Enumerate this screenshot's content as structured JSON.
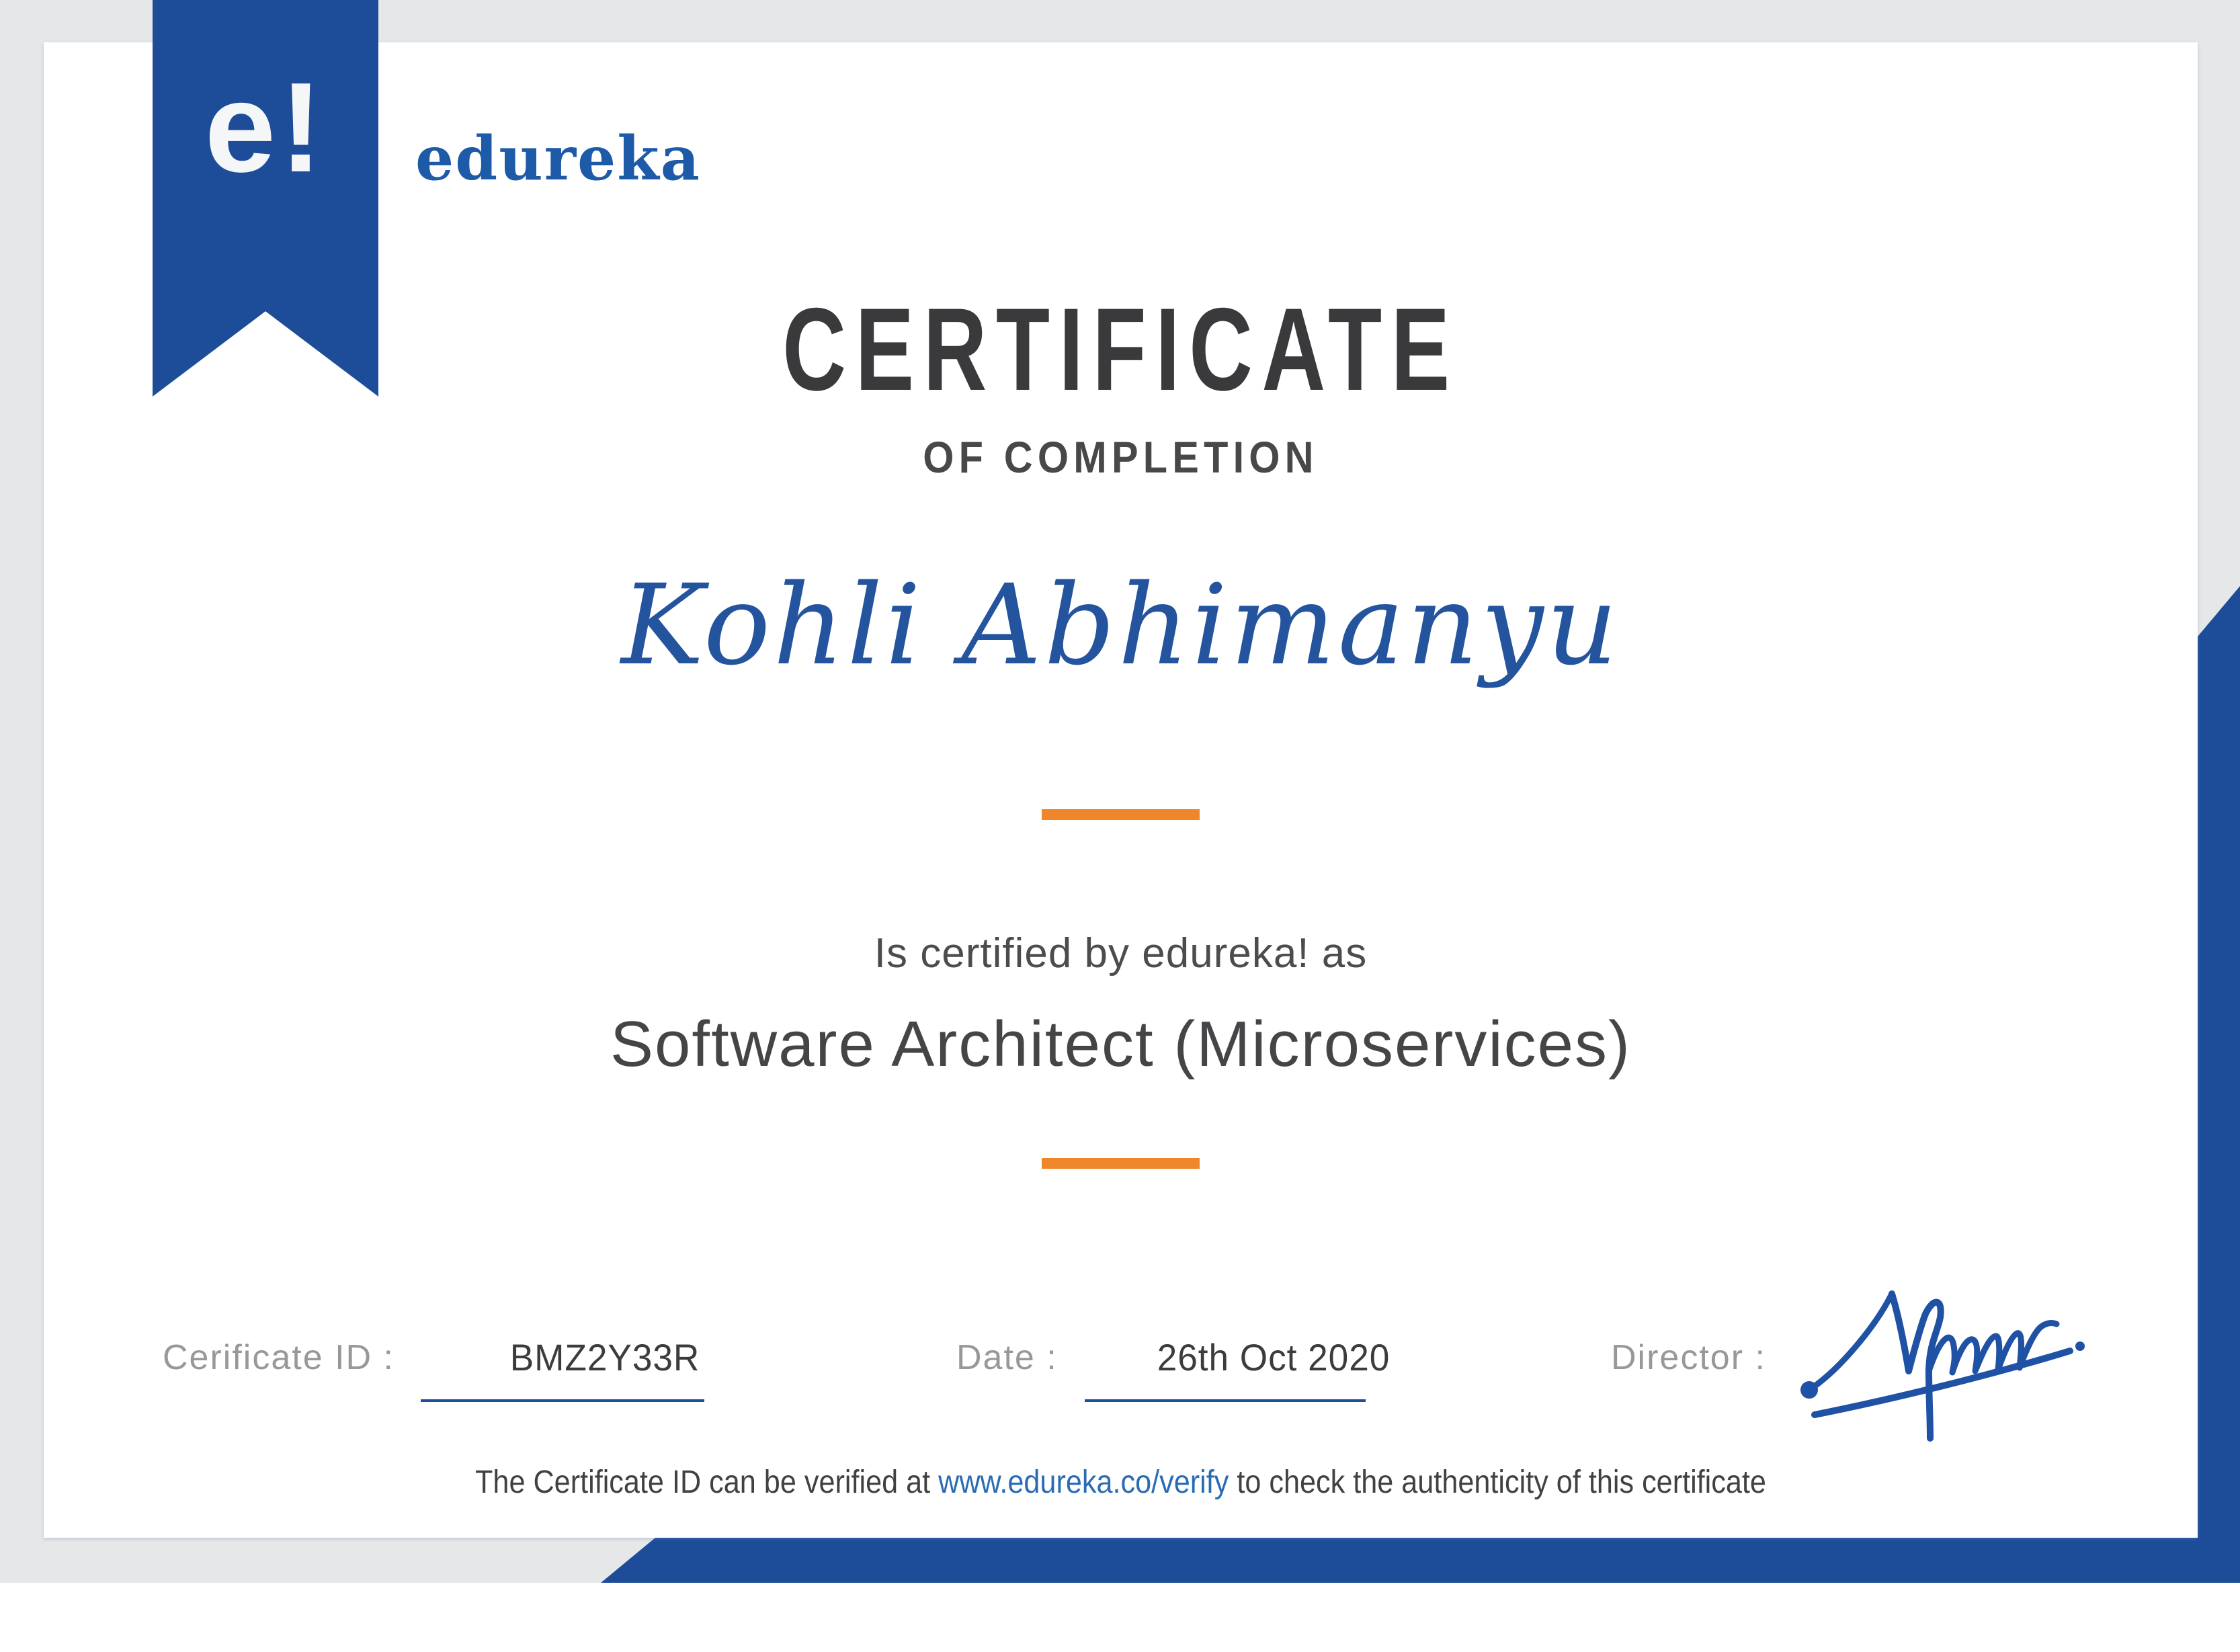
{
  "brand": {
    "logo_mark": "e!",
    "wordmark": "edureka"
  },
  "title": "CERTIFICATE",
  "subtitle": "OF COMPLETION",
  "recipient": "Kohli Abhimanyu",
  "certified_line": "Is certified by edureka! as",
  "course": "Software Architect (Microservices)",
  "footer": {
    "id_label": "Cerificate ID :",
    "id_value": "BMZ2Y33R",
    "date_label": "Date :",
    "date_value": "26th Oct 2020",
    "director_label": "Director :"
  },
  "verification": {
    "prefix": "The Certificate ID can be verified at ",
    "link": "www.edureka.co/verify",
    "suffix": " to check the authenticity of this certificate"
  },
  "colors": {
    "brand_blue": "#1d4d99",
    "wordmark_blue": "#1d5aa8",
    "name_blue": "#24549e",
    "accent_orange": "#f0862b",
    "link_blue": "#2a6cb4",
    "backdrop_gray": "#e6e7e9",
    "title_gray": "#3a3a3c"
  }
}
